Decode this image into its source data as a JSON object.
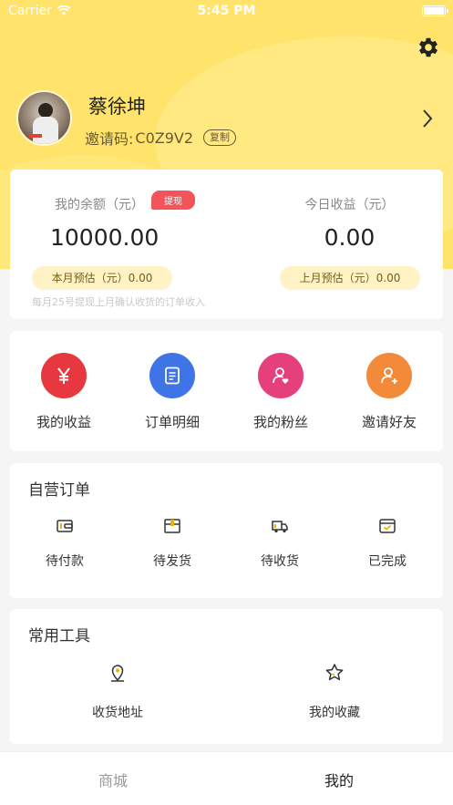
{
  "status_bar": {
    "carrier": "Carrier",
    "time": "5:45 PM"
  },
  "profile": {
    "name": "蔡徐坤",
    "invite_label": "邀请码:",
    "invite_code": "C0Z9V2",
    "copy_label": "复制"
  },
  "balance": {
    "balance_label": "我的余额（元）",
    "withdraw_label": "提现",
    "balance_value": "10000.00",
    "today_label": "今日收益（元）",
    "today_value": "0.00",
    "this_month": "本月预估（元）0.00",
    "last_month": "上月预估（元）0.00",
    "note": "每月25号提现上月确认收货的订单收入"
  },
  "quick_actions": [
    {
      "label": "我的收益",
      "icon": "yen-icon",
      "color": "#e8383f"
    },
    {
      "label": "订单明细",
      "icon": "document-icon",
      "color": "#3f74e6"
    },
    {
      "label": "我的粉丝",
      "icon": "user-heart-icon",
      "color": "#e5407c"
    },
    {
      "label": "邀请好友",
      "icon": "user-add-icon",
      "color": "#f28a3a"
    }
  ],
  "orders": {
    "title": "自营订单",
    "items": [
      {
        "label": "待付款",
        "icon": "wallet-icon"
      },
      {
        "label": "待发货",
        "icon": "box-icon"
      },
      {
        "label": "待收货",
        "icon": "truck-icon"
      },
      {
        "label": "已完成",
        "icon": "check-box-icon"
      }
    ]
  },
  "tools": {
    "title": "常用工具",
    "items": [
      {
        "label": "收货地址",
        "icon": "location-icon"
      },
      {
        "label": "我的收藏",
        "icon": "star-icon"
      }
    ]
  },
  "tabbar": {
    "tabs": [
      {
        "label": "商城",
        "active": false
      },
      {
        "label": "我的",
        "active": true
      }
    ]
  },
  "colors": {
    "header": "#ffe36a",
    "accent_red": "#f25459",
    "pill": "#fff3c6"
  }
}
